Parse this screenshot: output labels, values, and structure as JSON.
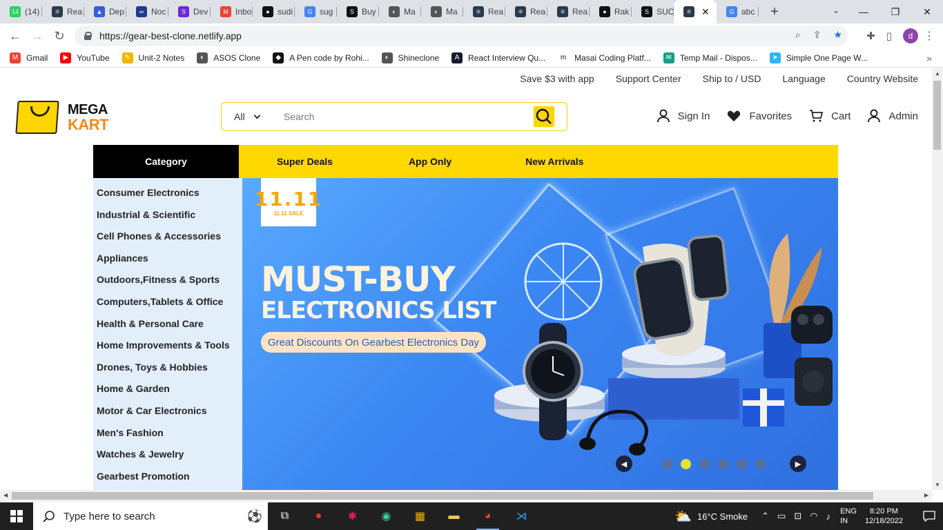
{
  "browser": {
    "tabs": [
      {
        "label": "(14)",
        "favicon_color": "#25d366",
        "favicon_text": "14"
      },
      {
        "label": "Rea",
        "favicon_color": "#2b3a4a",
        "favicon_text": "⚛"
      },
      {
        "label": "Dep",
        "favicon_color": "#3b5bdb",
        "favicon_text": "▲"
      },
      {
        "label": "Noc",
        "favicon_color": "#1e3a8a",
        "favicon_text": "∞"
      },
      {
        "label": "Dev",
        "favicon_color": "#6d28d9",
        "favicon_text": "S"
      },
      {
        "label": "Inbo",
        "favicon_color": "#ea4335",
        "favicon_text": "M"
      },
      {
        "label": "sudi",
        "favicon_color": "#111111",
        "favicon_text": "●"
      },
      {
        "label": "sug",
        "favicon_color": "#4285f4",
        "favicon_text": "G"
      },
      {
        "label": "Buy",
        "favicon_color": "#111111",
        "favicon_text": "S"
      },
      {
        "label": "Ma",
        "favicon_color": "#555555",
        "favicon_text": "◐"
      },
      {
        "label": "Ma",
        "favicon_color": "#555555",
        "favicon_text": "◐"
      },
      {
        "label": "Rea",
        "favicon_color": "#2b3a4a",
        "favicon_text": "⚛"
      },
      {
        "label": "Rea",
        "favicon_color": "#2b3a4a",
        "favicon_text": "⚛"
      },
      {
        "label": "Rea",
        "favicon_color": "#2b3a4a",
        "favicon_text": "⚛"
      },
      {
        "label": "Rak",
        "favicon_color": "#111111",
        "favicon_text": "●"
      },
      {
        "label": "SUC",
        "favicon_color": "#111111",
        "favicon_text": "S"
      },
      {
        "label": "",
        "favicon_color": "#2b3a4a",
        "favicon_text": "⚛",
        "active": true
      },
      {
        "label": "abc",
        "favicon_color": "#4285f4",
        "favicon_text": "G"
      }
    ],
    "url": "https://gear-best-clone.netlify.app",
    "profile_initial": "d",
    "bookmarks": [
      {
        "label": "Gmail",
        "color": "#ea4335",
        "icon": "M"
      },
      {
        "label": "YouTube",
        "color": "#ff0000",
        "icon": "▶"
      },
      {
        "label": "Unit-2 Notes",
        "color": "#f4b400",
        "icon": "✎"
      },
      {
        "label": "ASOS Clone",
        "color": "#555555",
        "icon": "◐"
      },
      {
        "label": "A Pen code by Rohi...",
        "color": "#111111",
        "icon": "◆"
      },
      {
        "label": "Shineclone",
        "color": "#555555",
        "icon": "◐"
      },
      {
        "label": "React Interview Qu...",
        "color": "#1a1a2e",
        "icon": "A"
      },
      {
        "label": "Masai Coding Platf...",
        "color": "#ffffff",
        "icon": "m"
      },
      {
        "label": "Temp Mail - Dispos...",
        "color": "#16a085",
        "icon": "✉"
      },
      {
        "label": "Simple One Page W...",
        "color": "#29b6f6",
        "icon": "➤"
      }
    ]
  },
  "site": {
    "topnav": [
      "Save $3 with app",
      "Support Center",
      "Ship to / USD",
      "Language",
      "Country Website"
    ],
    "logo": {
      "line1": "MEGA",
      "line2": "KART"
    },
    "search": {
      "category": "All",
      "placeholder": "Search"
    },
    "user_nav": {
      "sign_in": "Sign In",
      "favorites": "Favorites",
      "cart": "Cart",
      "admin": "Admin"
    },
    "menu": {
      "category": "Category",
      "items": [
        "Super Deals",
        "App Only",
        "New Arrivals"
      ]
    },
    "categories": [
      "Consumer Electronics",
      "Industrial & Scientific",
      "Cell Phones & Accessories",
      "Appliances",
      "Outdoors,Fitness & Sports",
      "Computers,Tablets & Office",
      "Health & Personal Care",
      "Home Improvements & Tools",
      "Drones, Toys & Hobbies",
      "Home & Garden",
      "Motor & Car Electronics",
      "Men's Fashion",
      "Watches & Jewelry",
      "Gearbest Promotion"
    ],
    "banner": {
      "badge_big": "11.11",
      "badge_small": "11.11 SALE",
      "headline1": "MUST-BUY",
      "headline2": "ELECTRONICS LIST",
      "promo": "Great Discounts On Gearbest Electronics Day",
      "slide_count": 6,
      "active_slide_index": 1
    },
    "colors": {
      "accent": "#ffd800",
      "logo_orange": "#f08a1c"
    }
  },
  "taskbar": {
    "search_placeholder": "Type here to search",
    "weather": "16°C  Smoke",
    "lang_line1": "ENG",
    "lang_line2": "IN",
    "time": "8:20 PM",
    "date": "12/18/2022"
  }
}
